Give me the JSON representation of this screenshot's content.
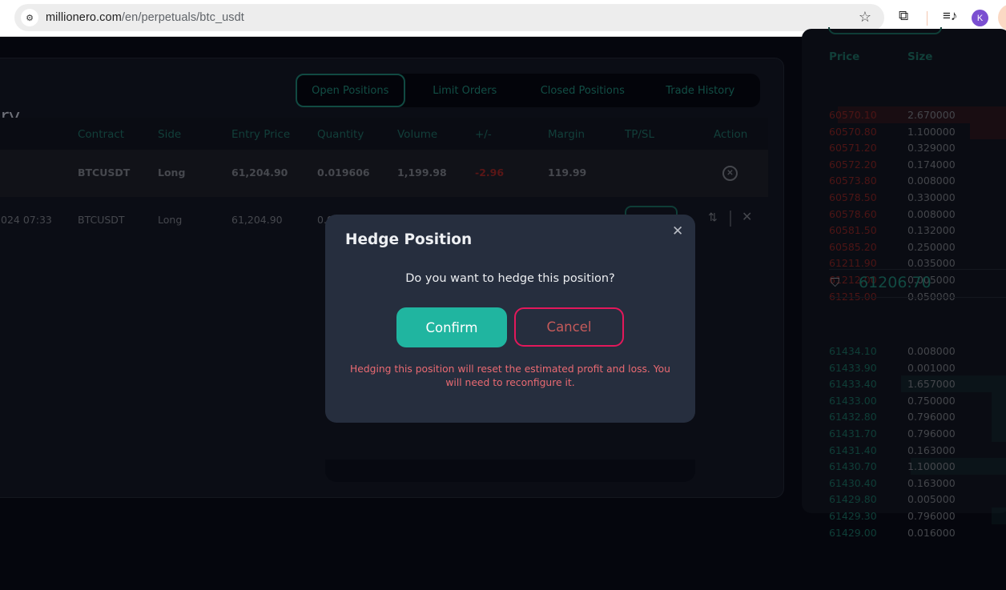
{
  "browser": {
    "url_domain": "millionero.com",
    "url_path": "/en/perpetuals/btc_usdt",
    "profile_initial": "K",
    "icons": [
      "site-settings-icon",
      "bookmark-star-icon",
      "extensions-icon",
      "media-control-icon",
      "profile-avatar"
    ]
  },
  "panel": {
    "title_fragment": "ry",
    "tabs": [
      {
        "label": "Open Positions",
        "active": true
      },
      {
        "label": "Limit Orders",
        "active": false
      },
      {
        "label": "Closed Positions",
        "active": false
      },
      {
        "label": "Trade History",
        "active": false
      }
    ],
    "columns": [
      "Contract",
      "Side",
      "Entry Price",
      "Quantity",
      "Volume",
      "+/-",
      "Margin",
      "TP/SL",
      "Action"
    ],
    "rows": [
      {
        "time": "",
        "contract": "BTCUSDT",
        "side": "Long",
        "entry_price": "61,204.90",
        "quantity": "0.019606",
        "volume": "1,199.98",
        "pnl": "-2.96",
        "margin": "119.99"
      },
      {
        "time": "024 07:33",
        "contract": "BTCUSDT",
        "side": "Long",
        "entry_price": "61,204.90",
        "quantity": "0.0"
      }
    ]
  },
  "orderbook": {
    "headers": {
      "price": "Price",
      "size": "Size"
    },
    "asks": [
      {
        "price": "60570.10",
        "size": "2.670000",
        "depth": 0.95
      },
      {
        "price": "60570.80",
        "size": "1.100000",
        "depth": 0.22
      },
      {
        "price": "60571.20",
        "size": "0.329000",
        "depth": 0
      },
      {
        "price": "60572.20",
        "size": "0.174000",
        "depth": 0
      },
      {
        "price": "60573.80",
        "size": "0.008000",
        "depth": 0
      },
      {
        "price": "60578.50",
        "size": "0.330000",
        "depth": 0
      },
      {
        "price": "60578.60",
        "size": "0.008000",
        "depth": 0
      },
      {
        "price": "60581.50",
        "size": "0.132000",
        "depth": 0
      },
      {
        "price": "60585.20",
        "size": "0.250000",
        "depth": 0
      },
      {
        "price": "61211.90",
        "size": "0.035000",
        "depth": 0
      },
      {
        "price": "61212.00",
        "size": "0.005000",
        "depth": 0
      },
      {
        "price": "61215.00",
        "size": "0.050000",
        "depth": 0
      }
    ],
    "mid_price": "61206.70",
    "bids": [
      {
        "price": "61434.10",
        "size": "0.008000",
        "depth": 0
      },
      {
        "price": "61433.90",
        "size": "0.001000",
        "depth": 0
      },
      {
        "price": "61433.40",
        "size": "1.657000",
        "depth": 0.6
      },
      {
        "price": "61433.00",
        "size": "0.750000",
        "depth": 0.1
      },
      {
        "price": "61432.80",
        "size": "0.796000",
        "depth": 0.1
      },
      {
        "price": "61431.70",
        "size": "0.796000",
        "depth": 0.1
      },
      {
        "price": "61431.40",
        "size": "0.163000",
        "depth": 0
      },
      {
        "price": "61430.70",
        "size": "1.100000",
        "depth": 0.55
      },
      {
        "price": "61430.40",
        "size": "0.163000",
        "depth": 0
      },
      {
        "price": "61429.80",
        "size": "0.005000",
        "depth": 0
      },
      {
        "price": "61429.30",
        "size": "0.796000",
        "depth": 0.1
      },
      {
        "price": "61429.00",
        "size": "0.016000",
        "depth": 0
      }
    ]
  },
  "dialog": {
    "title": "Hedge Position",
    "question": "Do you want to hedge this position?",
    "confirm_label": "Confirm",
    "cancel_label": "Cancel",
    "warning": "Hedging this position will reset the estimated profit and loss. You will need to reconfigure it.",
    "colors": {
      "confirm": "#20b5a0",
      "cancel_border": "#e3185b",
      "warning": "#ea6a72"
    }
  }
}
